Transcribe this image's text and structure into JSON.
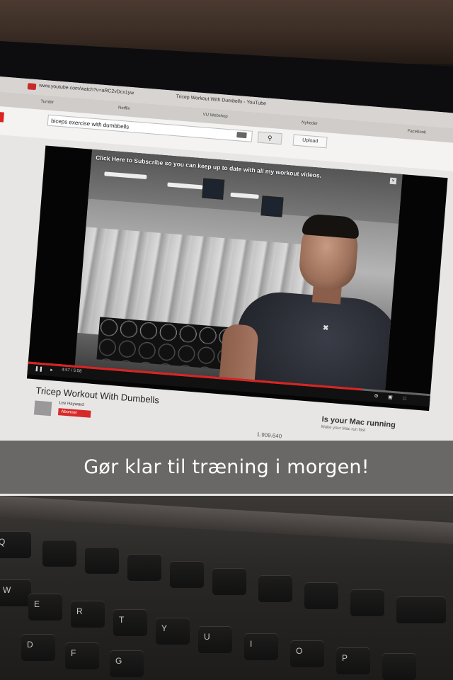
{
  "browser": {
    "url": "www.youtube.com/watch?v=aRC2vDcx1yw",
    "tab_title": "Tricep Workout With Dumbells - YouTube",
    "bookmarks": [
      "Tumblr",
      "Netflix",
      "VU Webshop",
      "Nyheder",
      "Facebook"
    ]
  },
  "youtube": {
    "search_query": "biceps exercise with dumbbells",
    "upload_label": "Upload",
    "annotation_text": "Click Here to Subscribe so you can keep up to date with all my workout videos.",
    "video_time": "4:57 / 5:58",
    "video_title": "Tricep Workout With Dumbells",
    "channel_name": "Lee Hayward",
    "subscribe_label": "Abonner",
    "view_count": "1.909.640",
    "ad_title": "Is your Mac running",
    "ad_subtitle": "Make your Mac run fast"
  },
  "overlay": {
    "caption": "Gør klar til træning i morgen!"
  },
  "keyboard": {
    "keys": [
      "Q",
      "W",
      "E",
      "R",
      "T",
      "Y",
      "U",
      "I",
      "O",
      "P",
      "D",
      "F",
      "G"
    ]
  }
}
